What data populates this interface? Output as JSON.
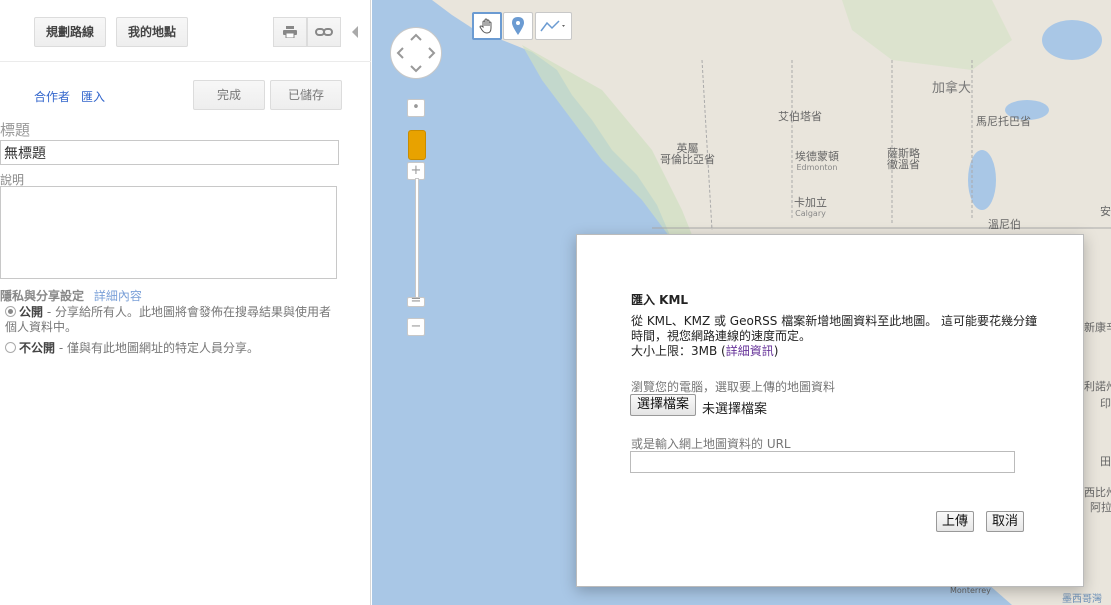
{
  "toolbar": {
    "route_label": "規劃路線",
    "my_places_label": "我的地點",
    "print_icon": "print-icon",
    "link_icon": "link-icon"
  },
  "editbar": {
    "collaborators": "合作者",
    "import": "匯入",
    "done": "完成",
    "saved": "已儲存"
  },
  "form": {
    "title_label": "標題",
    "title_value": "無標題",
    "description_label": "說明",
    "privacy_label": "隱私與分享設定",
    "privacy_details": "詳細內容",
    "public_label": "公開",
    "public_desc": " - 分享給所有人。此地圖將會發佈在搜尋結果與使用者個人資料中。",
    "unlisted_label": "不公開",
    "unlisted_desc": " - 僅與有此地圖網址的特定人員分享。"
  },
  "map_labels": {
    "canada": "加拿大",
    "alberta": "艾伯塔省",
    "manitoba": "馬尼托巴省",
    "bc_line1": "英屬",
    "bc_line2": "哥倫比亞省",
    "edmonton_zh": "埃德蒙頓",
    "edmonton_en": "Edmonton",
    "saskatoon_line1": "薩斯略",
    "saskatoon_line2": "徹溫省",
    "calgary_zh": "卡加立",
    "calgary_en": "Calgary",
    "winnipeg": "溫尼伯",
    "right_edge_1": "安",
    "right_edge_2": "新康辛",
    "right_edge_3": "利諾州",
    "right_edge_4": "印",
    "right_edge_5": "田",
    "right_edge_6": "西比州",
    "right_edge_7": "阿拉",
    "monterrey": "Monterrey",
    "mexico_gulf": "墨西哥灣"
  },
  "dialog": {
    "title": "匯入 KML",
    "description_main": "從 KML、KMZ 或 GeoRSS 檔案新增地圖資料至此地圖。 這可能要花幾分鐘時間，視您網路連線的速度而定。",
    "size_prefix": "大小上限：3MB (",
    "size_link": "詳細資訊",
    "size_suffix": ")",
    "browse_label": "瀏覽您的電腦，選取要上傳的地圖資料",
    "choose_file": "選擇檔案",
    "no_file": "未選擇檔案",
    "url_label": "或是輸入網上地圖資料的 URL",
    "url_value": "",
    "upload": "上傳",
    "cancel": "取消"
  },
  "colors": {
    "water": "#a9c7e6",
    "land": "#e9e5dc",
    "link": "#3366cc"
  }
}
